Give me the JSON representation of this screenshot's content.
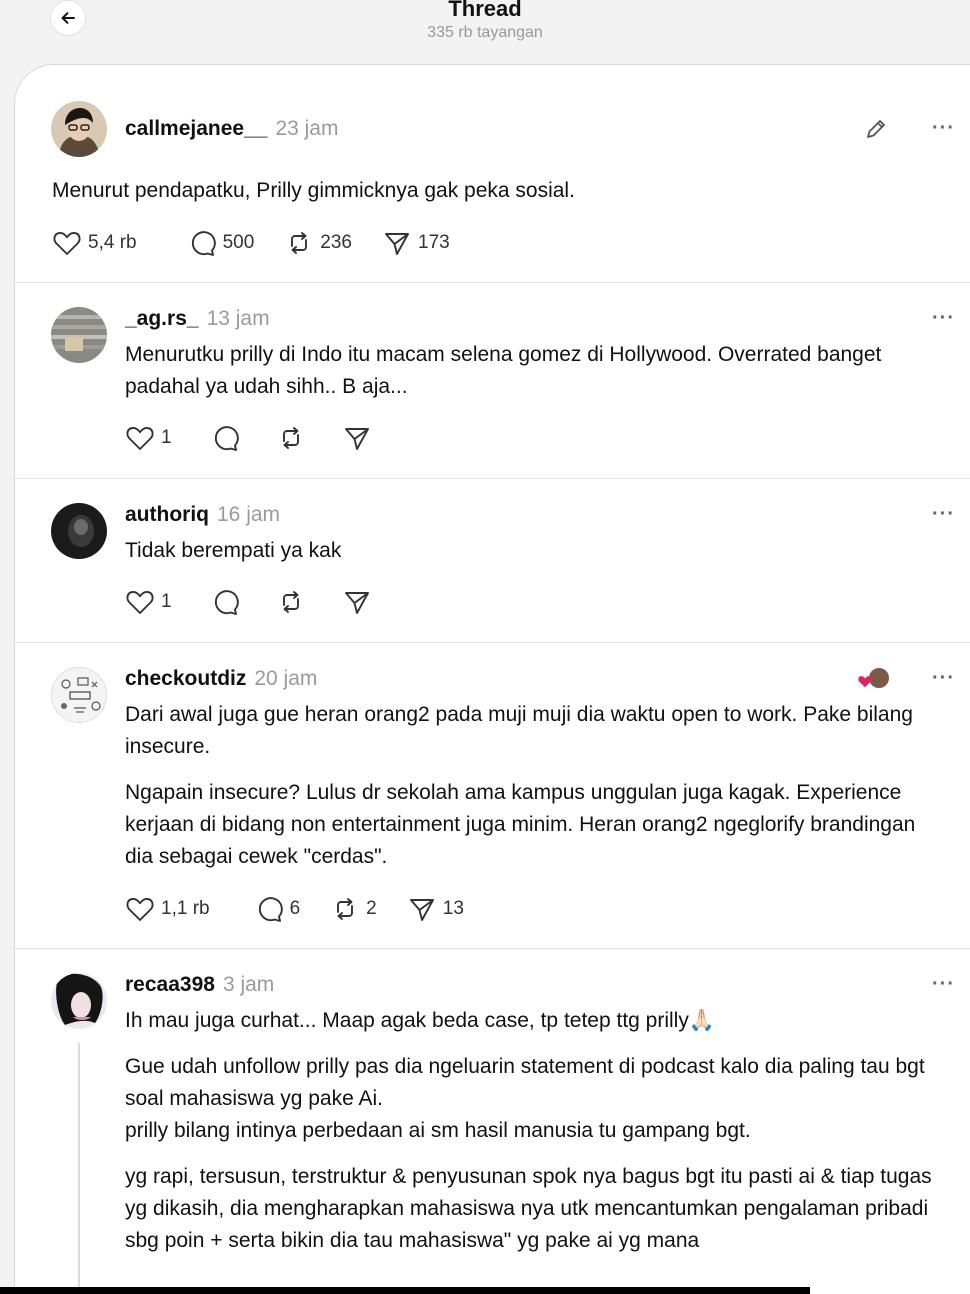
{
  "header": {
    "title": "Thread",
    "views": "335 rb tayangan",
    "back_icon": "arrow-left-icon"
  },
  "main_post": {
    "username": "callmejanee__",
    "time": "23 jam",
    "text": "Menurut pendapatku, Prilly gimmicknya gak peka sosial.",
    "likes": "5,4 rb",
    "replies": "500",
    "reposts": "236",
    "shares": "173",
    "edit_icon": "pencil-icon"
  },
  "replies": [
    {
      "username": "_ag.rs_",
      "time": "13 jam",
      "paragraphs": [
        "Menurutku prilly di Indo itu macam selena gomez di Hollywood. Overrated banget padahal ya udah sihh.. B aja..."
      ],
      "likes": "1",
      "replies": "",
      "reposts": "",
      "shares": ""
    },
    {
      "username": "authoriq",
      "time": "16 jam",
      "paragraphs": [
        "Tidak berempati ya kak"
      ],
      "likes": "1",
      "replies": "",
      "reposts": "",
      "shares": ""
    },
    {
      "username": "checkoutdiz",
      "time": "20 jam",
      "paragraphs": [
        "Dari awal juga gue heran orang2 pada muji muji dia waktu open to work. Pake bilang insecure.",
        "Ngapain insecure? Lulus dr sekolah ama kampus unggulan juga kagak. Experience kerjaan di bidang non entertainment juga minim. Heran orang2 ngeglorify brandingan dia sebagai cewek \"cerdas\"."
      ],
      "likes": "1,1 rb",
      "replies": "6",
      "reposts": "2",
      "shares": "13"
    },
    {
      "username": "recaa398",
      "time": "3 jam",
      "paragraphs": [
        "Ih mau juga curhat... Maap agak beda case, tp tetep ttg prilly🙏🏻",
        "Gue udah unfollow prilly pas dia ngeluarin statement di podcast kalo dia paling tau bgt soal mahasiswa yg pake Ai.",
        "prilly bilang intinya perbedaan ai sm hasil manusia tu gampang bgt.",
        "yg rapi, tersusun, terstruktur & penyusunan spok nya bagus bgt itu pasti ai & tiap tugas yg dikasih, dia mengharapkan mahasiswa nya utk mencantumkan pengalaman pribadi sbg poin + serta bikin dia tau mahasiswa\" yg pake ai yg mana"
      ]
    }
  ],
  "colors": {
    "like_heart": "#e0245e",
    "time": "#9a9a9a",
    "divider": "#e4e4e4"
  }
}
